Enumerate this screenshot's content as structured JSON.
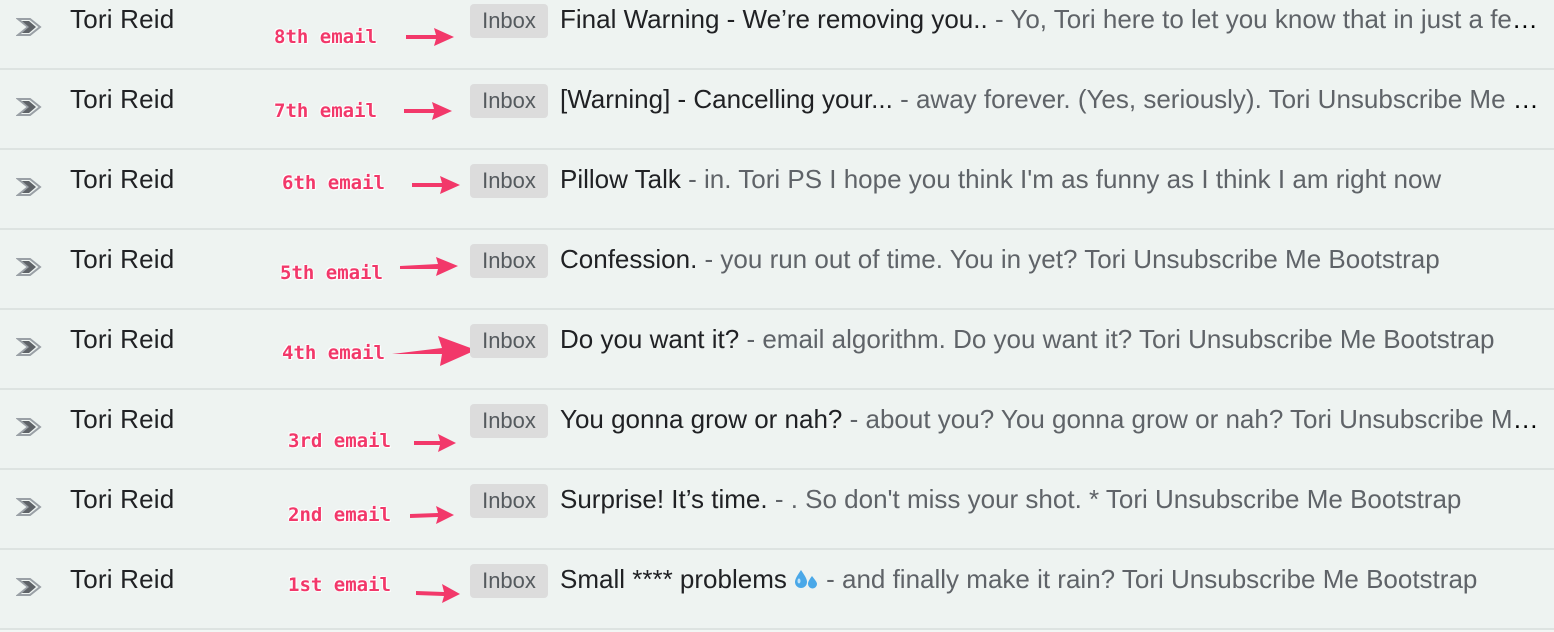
{
  "label_text": "Inbox",
  "separator": " - ",
  "colors": {
    "annotation": "#f2386a",
    "label_bg": "#dcdcdc",
    "row_bg": "#eef3f1"
  },
  "rows": [
    {
      "sender": "Tori Reid",
      "annotation": "8th email",
      "subject": "Final Warning - We’re removing you..",
      "snippet": "Yo, Tori here to let you know that in just a few hours"
    },
    {
      "sender": "Tori Reid",
      "annotation": "7th email",
      "subject": "[Warning] - Cancelling your...",
      "snippet": "away forever. (Yes, seriously). Tori Unsubscribe Me Bootstrap"
    },
    {
      "sender": "Tori Reid",
      "annotation": "6th email",
      "subject": "Pillow Talk",
      "snippet": "in. Tori PS I hope you think I'm as funny as I think I am right now"
    },
    {
      "sender": "Tori Reid",
      "annotation": "5th email",
      "subject": "Confession.",
      "snippet": "you run out of time. You in yet? Tori Unsubscribe Me Bootstrap"
    },
    {
      "sender": "Tori Reid",
      "annotation": "4th email",
      "subject": "Do you want it?",
      "snippet": "email algorithm. Do you want it? Tori Unsubscribe Me Bootstrap"
    },
    {
      "sender": "Tori Reid",
      "annotation": "3rd email",
      "subject": "You gonna grow or nah?",
      "snippet": "about you? You gonna grow or nah? Tori Unsubscribe Me Bootstrap"
    },
    {
      "sender": "Tori Reid",
      "annotation": "2nd email",
      "subject": "Surprise! It’s time.",
      "snippet": ". So don't miss your shot. * Tori Unsubscribe Me Bootstrap"
    },
    {
      "sender": "Tori Reid",
      "annotation": "1st email",
      "subject": "Small **** problems",
      "subject_icon": "sweat-droplets-emoji",
      "snippet": "and finally make it rain? Tori Unsubscribe Me Bootstrap"
    }
  ]
}
